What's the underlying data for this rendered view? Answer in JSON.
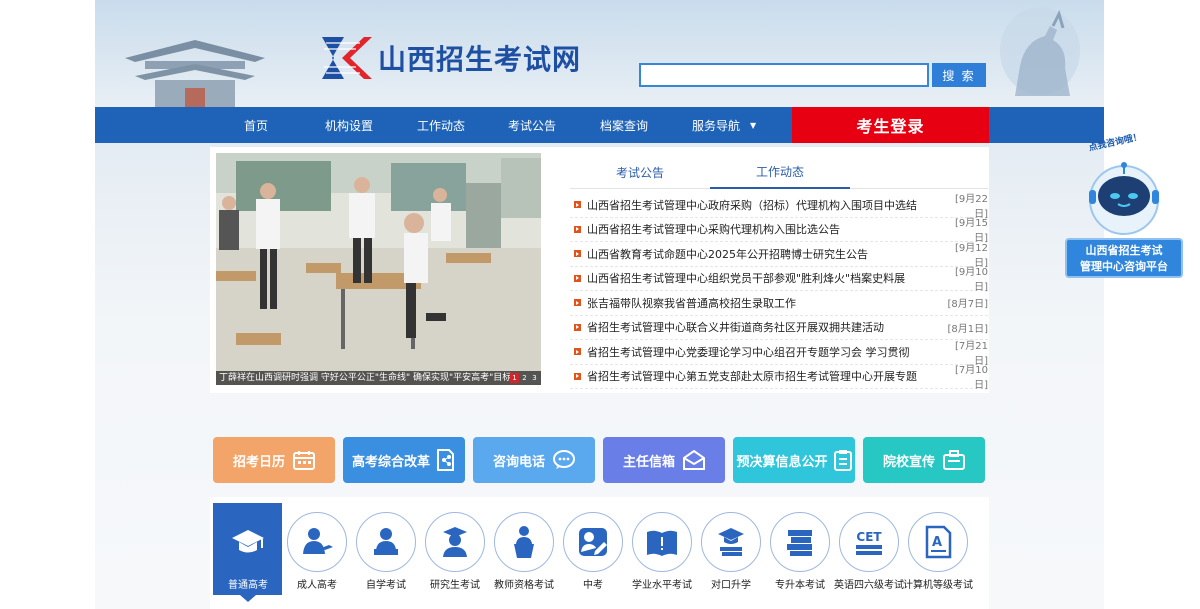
{
  "header": {
    "site_name": "山西招生考试网",
    "search": {
      "value": "",
      "button_label": "搜 索"
    }
  },
  "nav": {
    "items": [
      {
        "label": "首页"
      },
      {
        "label": "机构设置"
      },
      {
        "label": "工作动态"
      },
      {
        "label": "考试公告"
      },
      {
        "label": "档案查询"
      },
      {
        "label": "服务导航",
        "has_dropdown": true
      }
    ],
    "login_label": "考生登录"
  },
  "slideshow": {
    "caption": "丁薛祥在山西调研时强调 守好公平公正\"生命线\" 确保实现\"平安高考\"目标",
    "pages": [
      "1",
      "2",
      "3"
    ],
    "current_page": 1
  },
  "news": {
    "tabs": [
      {
        "label": "考试公告"
      },
      {
        "label": "工作动态",
        "active": true
      }
    ],
    "items": [
      {
        "title": "山西省招生考试管理中心政府采购（招标）代理机构入围项目中选结",
        "date": "[9月22日]"
      },
      {
        "title": "山西省招生考试管理中心采购代理机构入围比选公告",
        "date": "[9月15日]"
      },
      {
        "title": "山西省教育考试命题中心2025年公开招聘博士研究生公告",
        "date": "[9月12日]"
      },
      {
        "title": "山西省招生考试管理中心组织党员干部参观\"胜利烽火\"档案史料展",
        "date": "[9月10日]"
      },
      {
        "title": "张吉福带队视察我省普通高校招生录取工作",
        "date": "[8月7日]"
      },
      {
        "title": "省招生考试管理中心联合义井街道商务社区开展双拥共建活动",
        "date": "[8月1日]"
      },
      {
        "title": "省招生考试管理中心党委理论学习中心组召开专题学习会 学习贯彻",
        "date": "[7月21日]"
      },
      {
        "title": "省招生考试管理中心第五党支部赴太原市招生考试管理中心开展专题",
        "date": "[7月10日]"
      }
    ]
  },
  "quick_links": [
    {
      "label": "招考日历",
      "icon": "calendar-icon",
      "color": "#f3a468"
    },
    {
      "label": "高考综合改革",
      "icon": "document-share-icon",
      "color": "#3a8fe0"
    },
    {
      "label": "咨询电话",
      "icon": "chat-bubble-icon",
      "color": "#5aa8ee"
    },
    {
      "label": "主任信箱",
      "icon": "mail-icon",
      "color": "#6a7ee8"
    },
    {
      "label": "预决算信息公开",
      "icon": "clipboard-icon",
      "color": "#2fc6dc"
    },
    {
      "label": "院校宣传",
      "icon": "briefcase-icon",
      "color": "#27c7c4"
    }
  ],
  "categories": [
    {
      "label": "普通高考",
      "icon": "graduation-cap-icon",
      "active": true
    },
    {
      "label": "成人高考",
      "icon": "adult-student-icon"
    },
    {
      "label": "自学考试",
      "icon": "self-study-icon"
    },
    {
      "label": "研究生考试",
      "icon": "graduate-icon"
    },
    {
      "label": "教师资格考试",
      "icon": "teacher-podium-icon"
    },
    {
      "label": "中考",
      "icon": "edit-pencil-icon"
    },
    {
      "label": "学业水平考试",
      "icon": "open-book-icon"
    },
    {
      "label": "对口升学",
      "icon": "cap-books-icon"
    },
    {
      "label": "专升本考试",
      "icon": "book-stack-icon"
    },
    {
      "label": "英语四六级考试",
      "icon": "cet-icon",
      "icon_text": "CET"
    },
    {
      "label": "计算机等级考试",
      "icon": "certificate-icon"
    }
  ],
  "assistant": {
    "bubble": "点我咨询哦！",
    "label_line1": "山西省招生考试",
    "label_line2": "管理中心咨询平台"
  },
  "colors": {
    "nav_blue": "#1e63b8",
    "login_red": "#e60012",
    "link_blue": "#2a5da8"
  }
}
